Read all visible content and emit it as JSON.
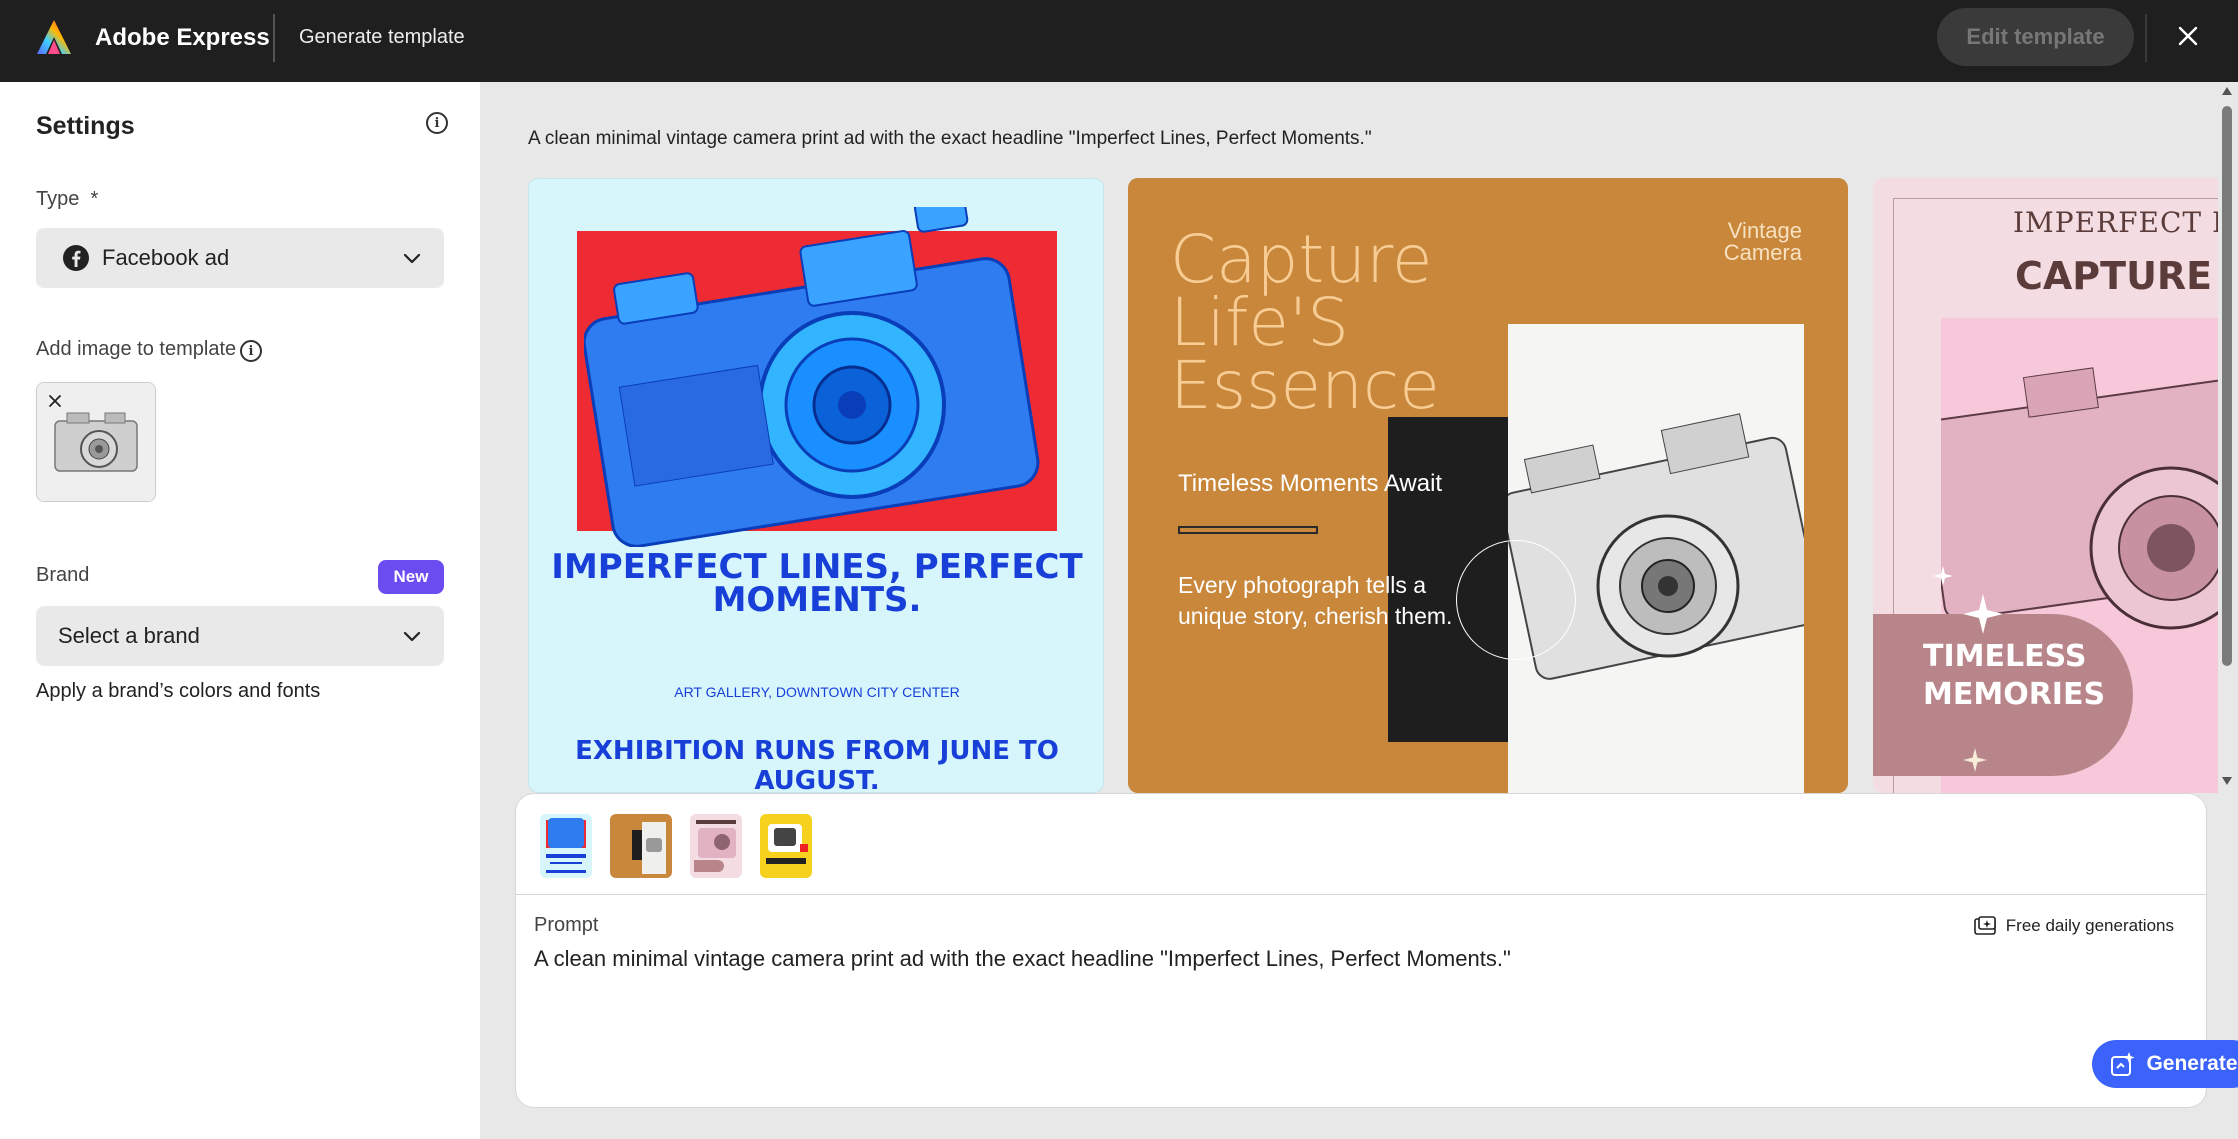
{
  "header": {
    "app_name": "Adobe Express",
    "page_title": "Generate template",
    "edit_button": "Edit template"
  },
  "sidebar": {
    "title": "Settings",
    "type_label": "Type",
    "type_required": "*",
    "type_value": "Facebook ad",
    "add_image_label": "Add image to template",
    "brand_label": "Brand",
    "brand_badge": "New",
    "brand_placeholder": "Select a brand",
    "brand_note": "Apply a brand’s colors and fonts"
  },
  "main": {
    "prompt_echo": "A clean minimal vintage camera print ad with the exact headline \"Imperfect Lines, Perfect Moments.\"",
    "cards": [
      {
        "headline": "IMPERFECT LINES, PERFECT MOMENTS.",
        "location": "ART GALLERY, DOWNTOWN CITY CENTER",
        "footer": "EXHIBITION RUNS FROM JUNE TO AUGUST."
      },
      {
        "title": "Capture Life'S Essence",
        "corner": "Vintage Camera",
        "subtitle": "Timeless Moments Await",
        "body": "Every photograph tells a unique story, cherish them."
      },
      {
        "top": "IMPERFECT LIN",
        "big": "CAPTURE LI",
        "blob": "TIMELESS MEMORIES"
      }
    ]
  },
  "panel": {
    "prompt_label": "Prompt",
    "prompt_value": "A clean minimal vintage camera print ad with the exact headline \"Imperfect Lines, Perfect Moments.\"",
    "free_generations": "Free daily generations",
    "generate_button": "Generate"
  },
  "colors": {
    "accent": "#3b63fb",
    "badge": "#6a4cf0",
    "header_bg": "#1f1f1f"
  }
}
